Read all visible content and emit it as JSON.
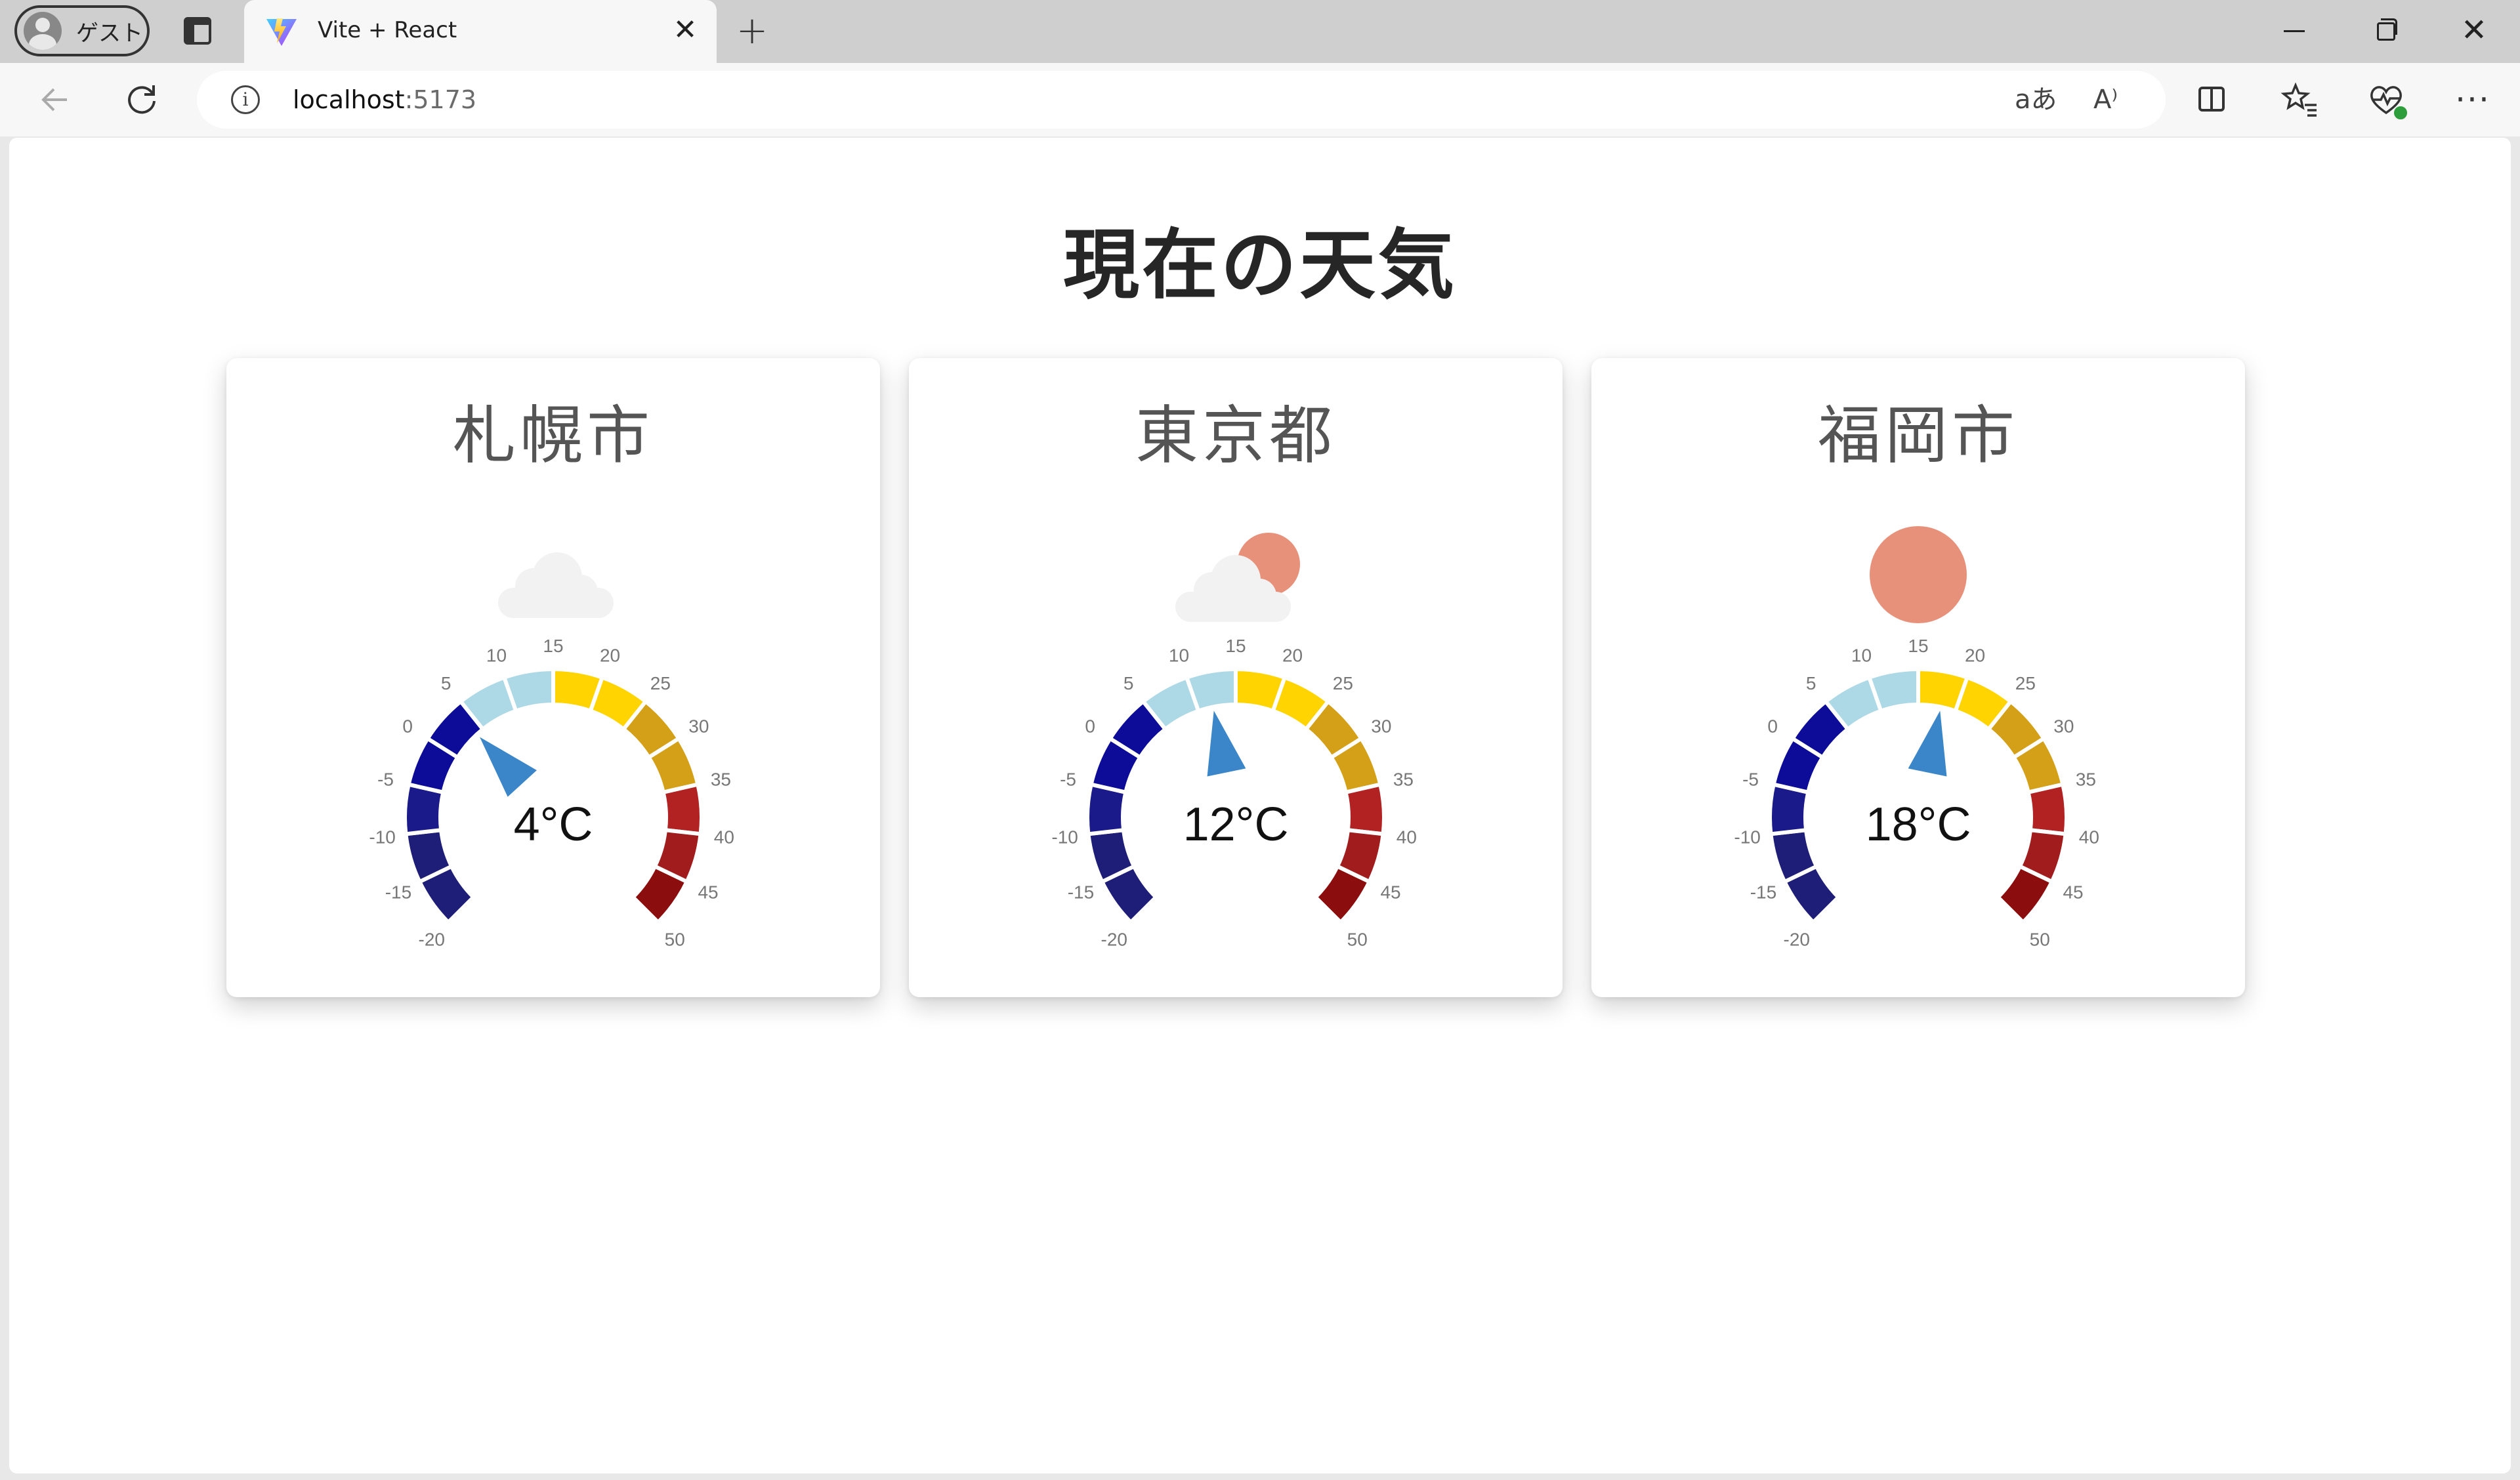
{
  "browser": {
    "profile_label": "ゲスト",
    "tab_title": "Vite + React",
    "url_host": "localhost",
    "url_port": ":5173",
    "new_tab_symbol": "+",
    "close_symbol": "✕",
    "translate_icon_text": "aあ",
    "read_aloud_icon_text": "A⁾"
  },
  "page": {
    "title": "現在の天気"
  },
  "gauge_scale": {
    "min": -20,
    "max": 50,
    "tick_labels": [
      "-20",
      "-15",
      "-10",
      "-5",
      "0",
      "5",
      "10",
      "15",
      "20",
      "25",
      "30",
      "35",
      "40",
      "45",
      "50"
    ],
    "unit": "°C",
    "segment_colors": [
      "#1e1e78",
      "#1e1e78",
      "#1a1a8a",
      "#0c0c98",
      "#0c0c98",
      "#add8e6",
      "#add8e6",
      "#ffd400",
      "#ffd400",
      "#d4a017",
      "#d4a017",
      "#b22222",
      "#a11d1d",
      "#8b0d0d",
      "#8b0000"
    ]
  },
  "cities": [
    {
      "name": "札幌市",
      "temperature": 4,
      "temp_label": "4°C",
      "weather": "cloudy",
      "icon_name": "cloud-icon"
    },
    {
      "name": "東京都",
      "temperature": 12,
      "temp_label": "12°C",
      "weather": "partly-cloudy",
      "icon_name": "sun-behind-cloud-icon"
    },
    {
      "name": "福岡市",
      "temperature": 18,
      "temp_label": "18°C",
      "weather": "sunny",
      "icon_name": "sun-icon"
    }
  ],
  "colors": {
    "pointer": "#3a86c8",
    "sun": "#e8917a",
    "cloud": "#f2f2f2"
  }
}
